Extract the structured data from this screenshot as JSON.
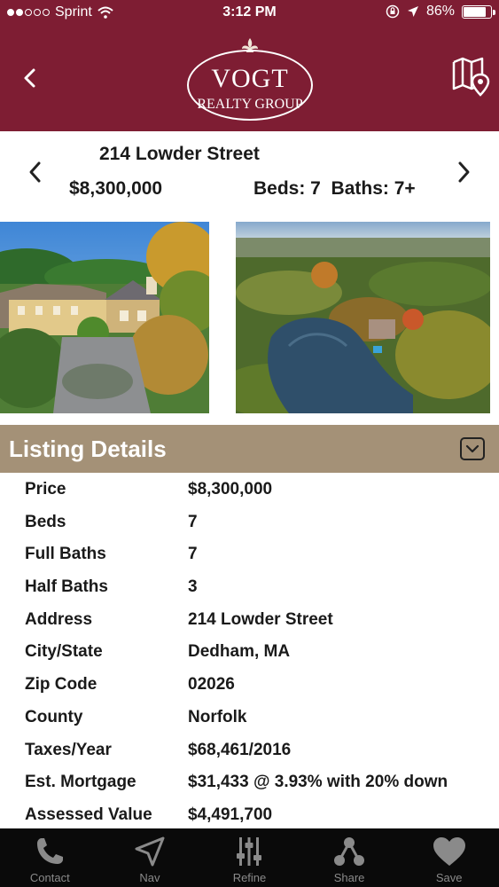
{
  "status_bar": {
    "carrier": "Sprint",
    "time": "3:12 PM",
    "battery": "86%",
    "battery_level": 0.86,
    "signal_bars": 2
  },
  "header": {
    "logo_top": "VOGT",
    "logo_bottom": "REALTY GROUP",
    "background_color": "#7e1d33"
  },
  "listing": {
    "address": "214 Lowder Street",
    "price": "$8,300,000",
    "beds_baths": "Beds: 7  Baths: 7+"
  },
  "section": {
    "title": "Listing Details",
    "background_color": "#a49177"
  },
  "details": [
    {
      "label": "Price",
      "value": "$8,300,000"
    },
    {
      "label": "Beds",
      "value": "7"
    },
    {
      "label": "Full Baths",
      "value": "7"
    },
    {
      "label": "Half Baths",
      "value": "3"
    },
    {
      "label": "Address",
      "value": "214 Lowder Street"
    },
    {
      "label": "City/State",
      "value": "Dedham, MA"
    },
    {
      "label": "Zip Code",
      "value": "02026"
    },
    {
      "label": "County",
      "value": "Norfolk"
    },
    {
      "label": "Taxes/Year",
      "value": "$68,461/2016"
    },
    {
      "label": "Est. Mortgage",
      "value": "$31,433 @ 3.93% with 20% down"
    },
    {
      "label": "Assessed Value",
      "value": "$4,491,700"
    }
  ],
  "tabs": [
    {
      "label": "Contact",
      "icon": "phone-icon"
    },
    {
      "label": "Nav",
      "icon": "navigation-arrow-icon"
    },
    {
      "label": "Refine",
      "icon": "sliders-icon"
    },
    {
      "label": "Share",
      "icon": "share-icon"
    },
    {
      "label": "Save",
      "icon": "heart-icon"
    }
  ]
}
